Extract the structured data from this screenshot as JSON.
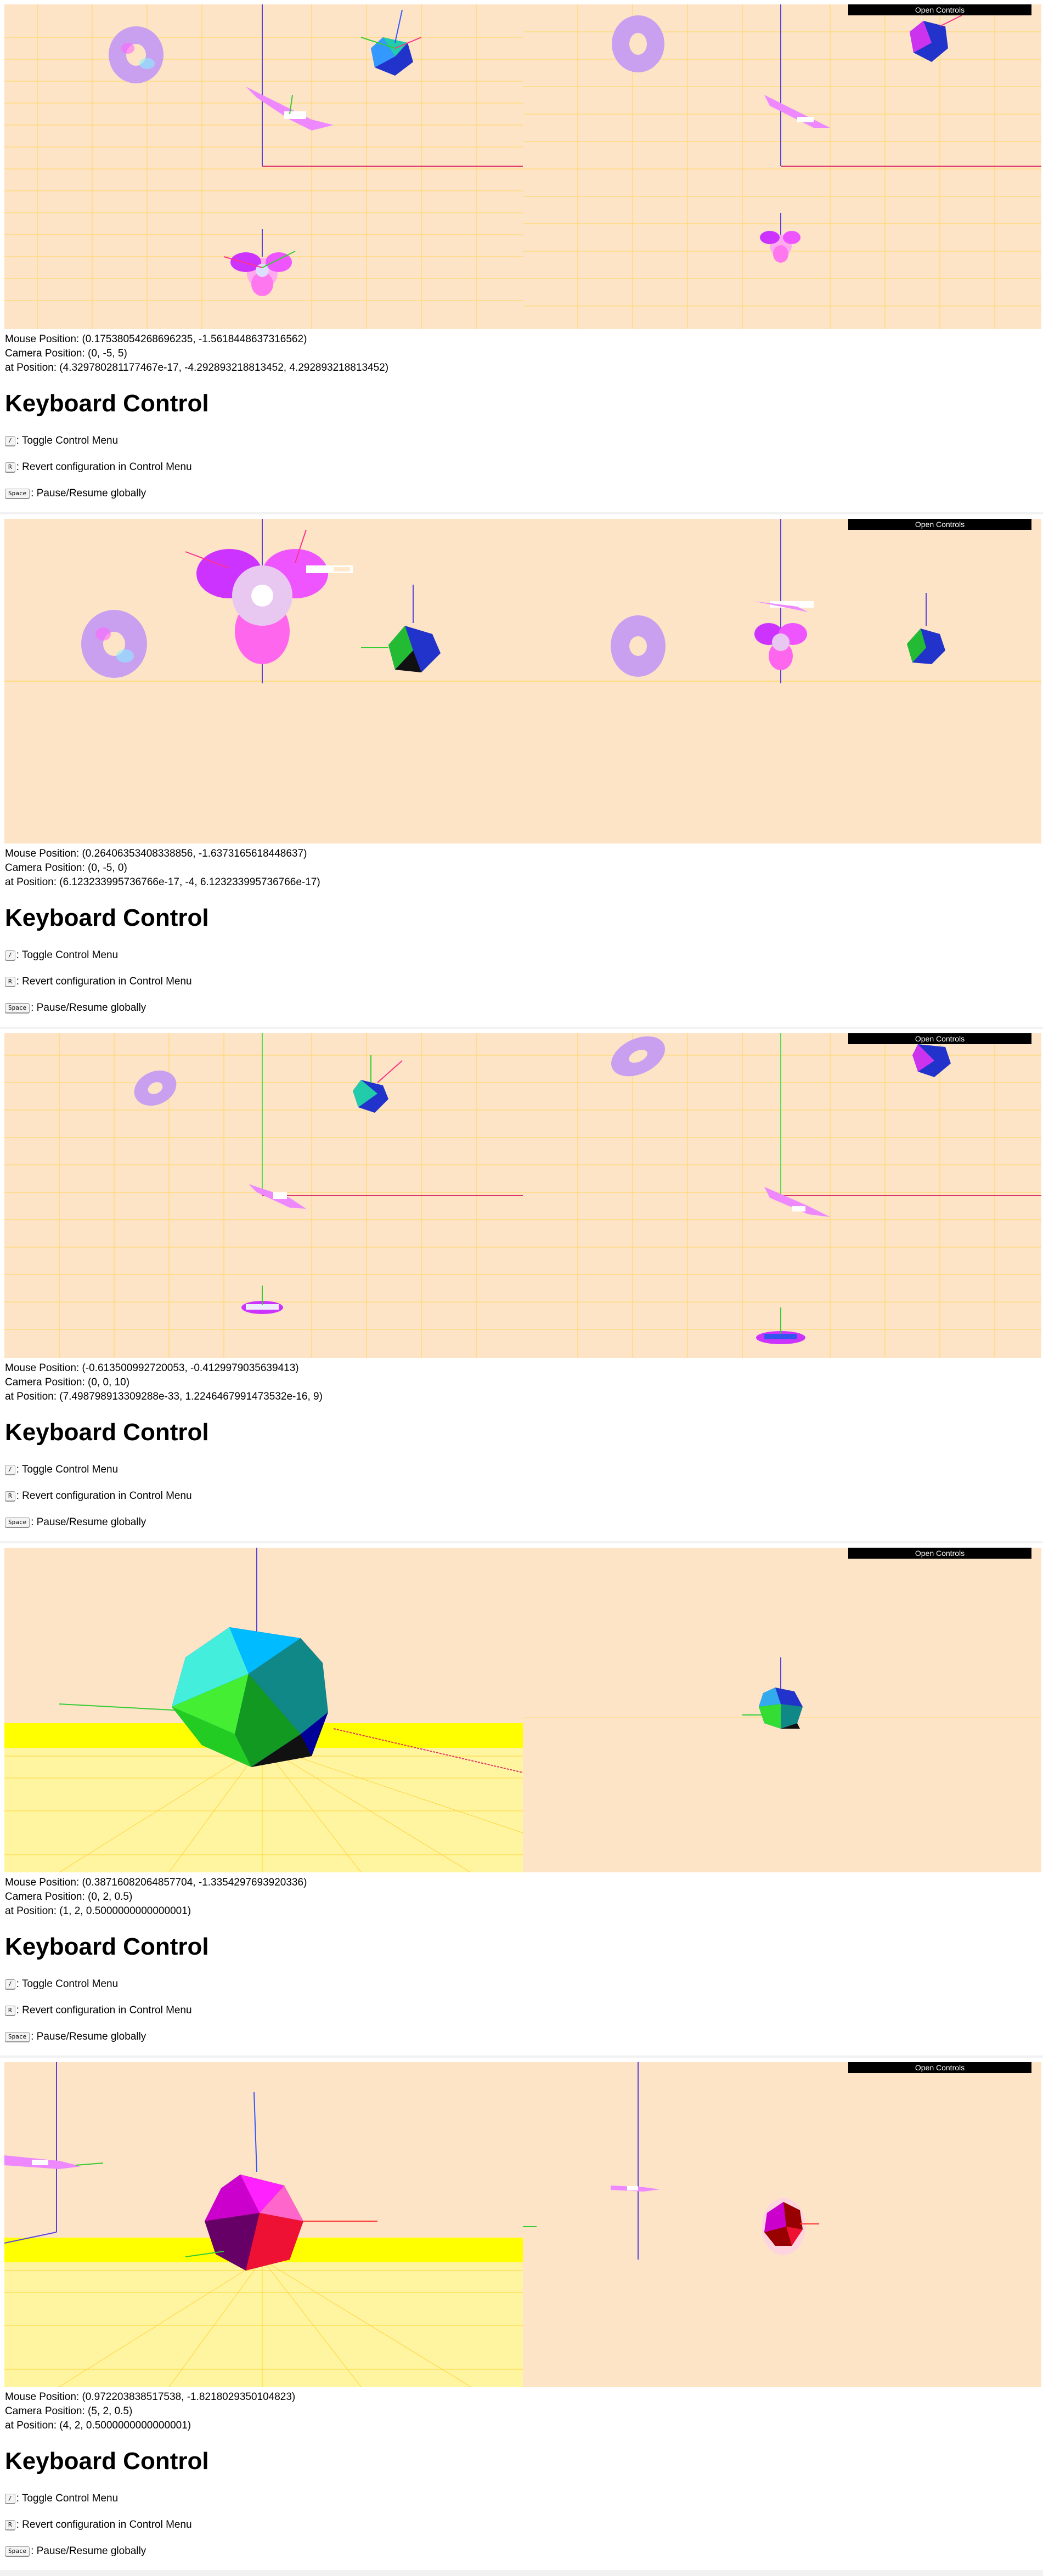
{
  "open_controls_label": "Open Controls",
  "keyboard": {
    "title": "Keyboard Control",
    "items": [
      {
        "key": "/",
        "desc": ": Toggle Control Menu"
      },
      {
        "key": "R",
        "desc": ": Revert configuration in Control Menu"
      },
      {
        "key": "Space",
        "desc": ": Pause/Resume globally"
      }
    ]
  },
  "colors": {
    "background": "#fde4c6",
    "grid": "#ffd700",
    "floor": "#ffff00",
    "axis_x": "#ff3366",
    "axis_y": "#33cc33",
    "axis_z": "#3333dd",
    "button": "#000000"
  },
  "panels": [
    {
      "mouse": "Mouse Position: (0.17538054268696235, -1.5618448637316562)",
      "camera": "Camera Position: (0, -5, 5)",
      "at": "at Position: (4.329780281177467e-17, -4.292893218813452, 4.292893218813452)"
    },
    {
      "mouse": "Mouse Position: (0.26406353408338856, -1.6373165618448637)",
      "camera": "Camera Position: (0, -5, 0)",
      "at": "at Position: (6.123233995736766e-17, -4, 6.123233995736766e-17)"
    },
    {
      "mouse": "Mouse Position: (-0.613500992720053, -0.4129979035639413)",
      "camera": "Camera Position: (0, 0, 10)",
      "at": "at Position: (7.498798913309288e-33, 1.2246467991473532e-16, 9)"
    },
    {
      "mouse": "Mouse Position: (0.38716082064857704, -1.3354297693920336)",
      "camera": "Camera Position: (0, 2, 0.5)",
      "at": "at Position: (1, 2, 0.5000000000000001)"
    },
    {
      "mouse": "Mouse Position: (0.972203838517538, -1.8218029350104823)",
      "camera": "Camera Position: (5, 2, 0.5)",
      "at": "at Position: (4, 2, 0.5000000000000001)"
    }
  ]
}
